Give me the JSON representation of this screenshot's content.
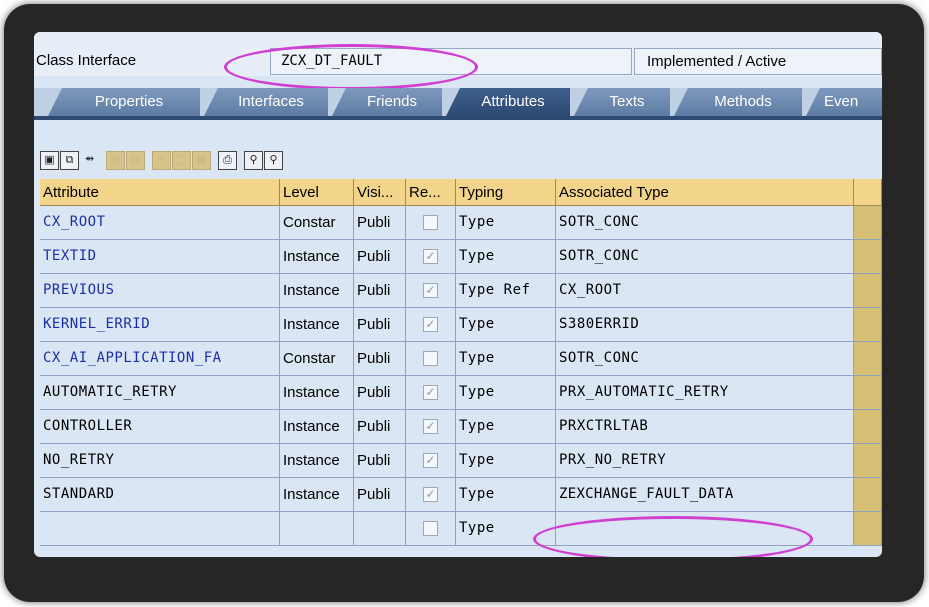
{
  "header": {
    "label": "Class Interface",
    "class_name": "ZCX_DT_FAULT",
    "status": "Implemented / Active"
  },
  "tabs": [
    {
      "label": "Properties",
      "active": false
    },
    {
      "label": "Interfaces",
      "active": false
    },
    {
      "label": "Friends",
      "active": false
    },
    {
      "label": "Attributes",
      "active": true
    },
    {
      "label": "Texts",
      "active": false
    },
    {
      "label": "Methods",
      "active": false
    },
    {
      "label": "Even",
      "active": false
    }
  ],
  "toolbar": {
    "icons": [
      "save-icon",
      "copy-icon",
      "navigate-icon",
      "insert-row-icon",
      "delete-row-icon",
      "cut-icon",
      "copy-row-icon",
      "paste-icon",
      "print-icon",
      "find-icon",
      "find-next-icon"
    ]
  },
  "table": {
    "columns": [
      "Attribute",
      "Level",
      "Visi...",
      "Re...",
      "Typing",
      "Associated Type"
    ],
    "rows": [
      {
        "attribute": "CX_ROOT",
        "level": "Constar",
        "visibility": "Publi",
        "readonly": false,
        "typing": "Type",
        "assoc": "SOTR_CONC",
        "highlight": true
      },
      {
        "attribute": "TEXTID",
        "level": "Instance",
        "visibility": "Publi",
        "readonly": true,
        "typing": "Type",
        "assoc": "SOTR_CONC",
        "highlight": true
      },
      {
        "attribute": "PREVIOUS",
        "level": "Instance",
        "visibility": "Publi",
        "readonly": true,
        "typing": "Type Ref",
        "assoc": "CX_ROOT",
        "highlight": true
      },
      {
        "attribute": "KERNEL_ERRID",
        "level": "Instance",
        "visibility": "Publi",
        "readonly": true,
        "typing": "Type",
        "assoc": "S380ERRID",
        "highlight": true
      },
      {
        "attribute": "CX_AI_APPLICATION_FA",
        "level": "Constar",
        "visibility": "Publi",
        "readonly": false,
        "typing": "Type",
        "assoc": "SOTR_CONC",
        "highlight": true
      },
      {
        "attribute": "AUTOMATIC_RETRY",
        "level": "Instance",
        "visibility": "Publi",
        "readonly": true,
        "typing": "Type",
        "assoc": "PRX_AUTOMATIC_RETRY",
        "highlight": false
      },
      {
        "attribute": "CONTROLLER",
        "level": "Instance",
        "visibility": "Publi",
        "readonly": true,
        "typing": "Type",
        "assoc": "PRXCTRLTAB",
        "highlight": false
      },
      {
        "attribute": "NO_RETRY",
        "level": "Instance",
        "visibility": "Publi",
        "readonly": true,
        "typing": "Type",
        "assoc": "PRX_NO_RETRY",
        "highlight": false
      },
      {
        "attribute": "STANDARD",
        "level": "Instance",
        "visibility": "Publi",
        "readonly": true,
        "typing": "Type",
        "assoc": "ZEXCHANGE_FAULT_DATA",
        "highlight": false
      },
      {
        "attribute": "",
        "level": "",
        "visibility": "",
        "readonly": false,
        "typing": "Type",
        "assoc": "",
        "highlight": false
      }
    ]
  },
  "colors": {
    "highlight_text": "#1b2fa7",
    "annotation": "#d13fd1",
    "header_bg": "#f2d48a",
    "tab_active": "#2d4a73"
  }
}
